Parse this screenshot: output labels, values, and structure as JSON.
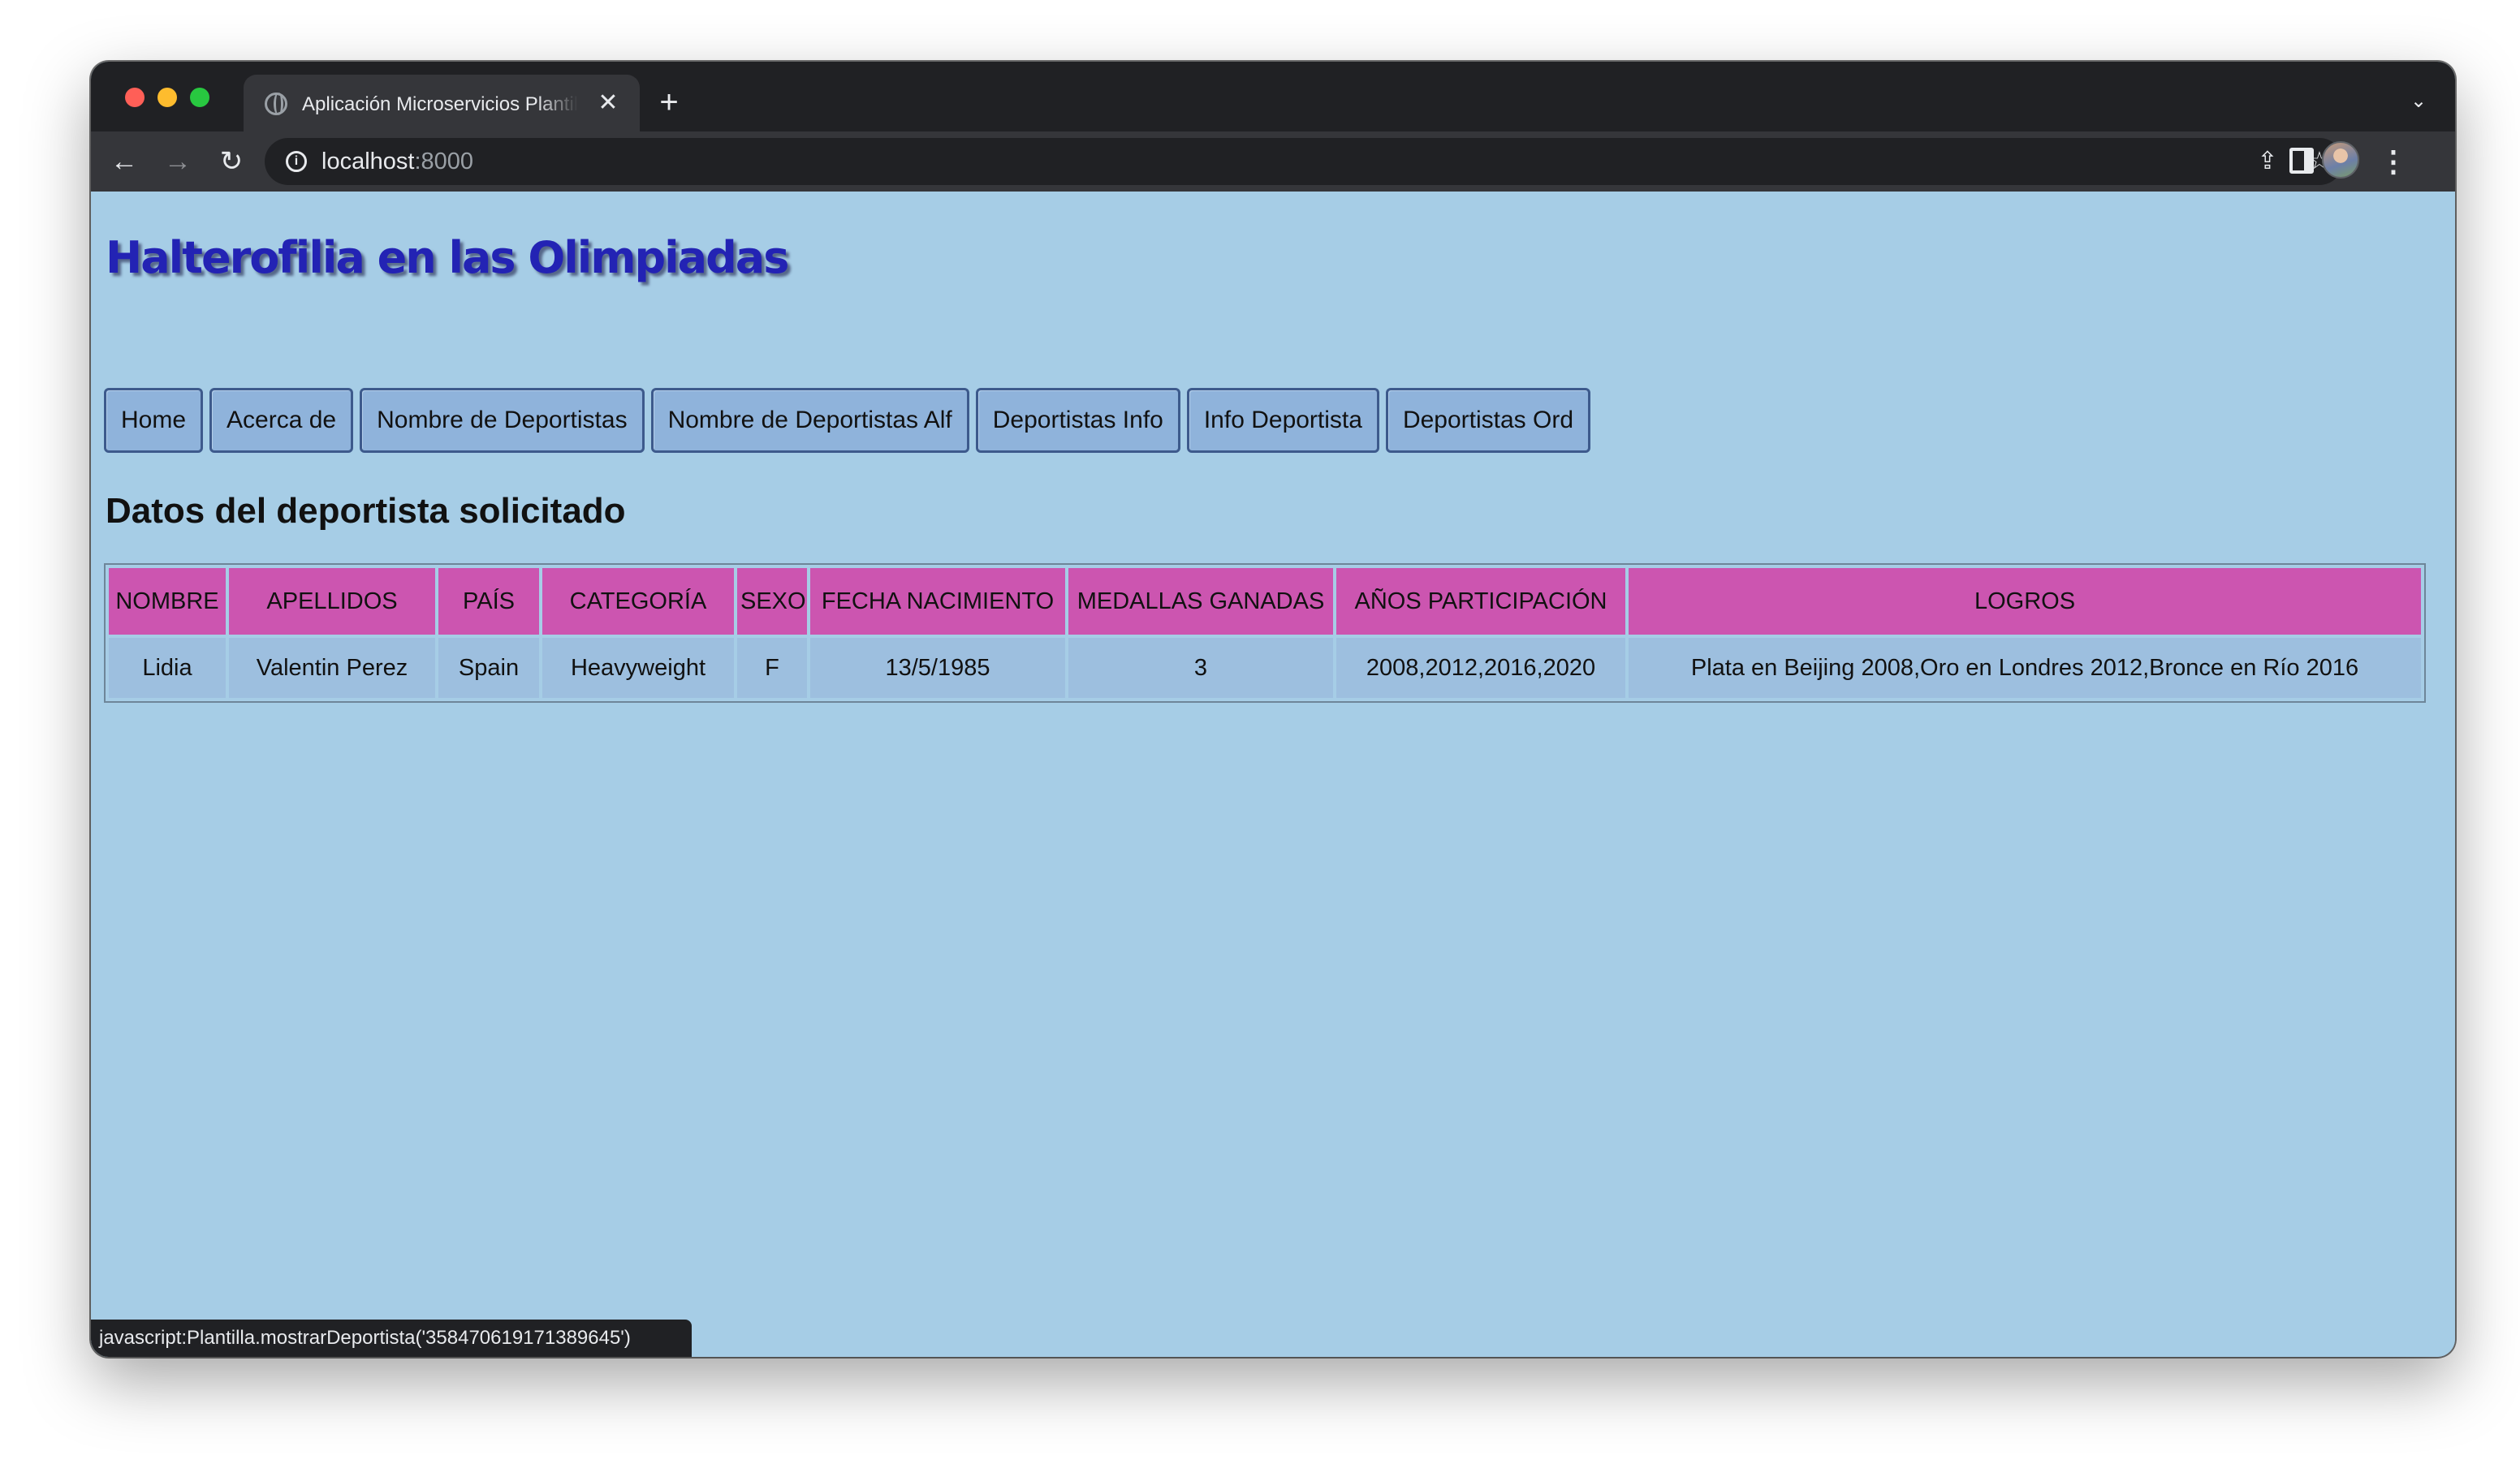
{
  "browser": {
    "tab_title": "Aplicación Microservicios Plantilla",
    "tab_close": "✕",
    "new_tab": "+",
    "tab_menu": "⌄",
    "url_host": "localhost",
    "url_port": ":8000",
    "status_text": "javascript:Plantilla.mostrarDeportista('358470619171389645')",
    "icons": {
      "back": "arrow-left-icon",
      "forward": "arrow-right-icon",
      "reload": "reload-icon",
      "info": "info-icon",
      "share": "share-icon",
      "bookmark": "star-icon",
      "side_panel": "side-panel-icon",
      "profile": "avatar",
      "menu": "kebab-menu-icon"
    }
  },
  "page": {
    "title": "Halterofilia en las Olimpiadas",
    "nav": [
      "Home",
      "Acerca de",
      "Nombre de Deportistas",
      "Nombre de Deportistas Alf",
      "Deportistas Info",
      "Info Deportista",
      "Deportistas Ord"
    ],
    "section_title": "Datos del deportista solicitado",
    "table": {
      "headers": [
        "NOMBRE",
        "APELLIDOS",
        "PAÍS",
        "CATEGORÍA",
        "SEXO",
        "FECHA NACIMIENTO",
        "MEDALLAS GANADAS",
        "AÑOS PARTICIPACIÓN",
        "LOGROS"
      ],
      "rows": [
        [
          "Lidia",
          "Valentin Perez",
          "Spain",
          "Heavyweight",
          "F",
          "13/5/1985",
          "3",
          "2008,2012,2016,2020",
          "Plata en Beijing 2008,Oro en Londres 2012,Bronce en Río 2016"
        ]
      ]
    }
  },
  "colors": {
    "page_background": "#a6cde6",
    "title_text": "#2323b4",
    "header_cell": "#cc55b0",
    "data_cell": "#9dbfdf",
    "nav_button": "#8fb3db"
  }
}
